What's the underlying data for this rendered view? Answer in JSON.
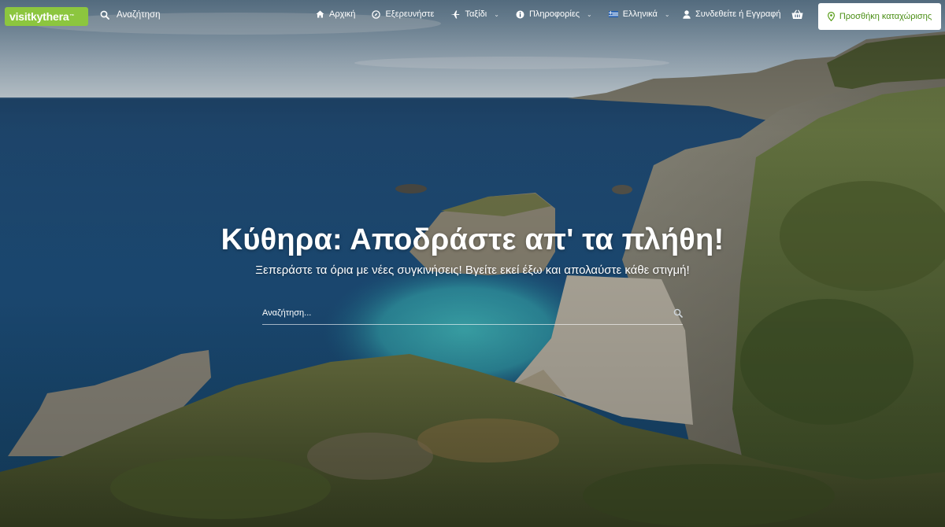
{
  "brand": {
    "logo_text": "visitkythera",
    "trademark": "™",
    "accent_color": "#8cc63f"
  },
  "header": {
    "search_label": "Αναζήτηση",
    "nav": [
      {
        "label": "Αρχική",
        "icon": "home-icon"
      },
      {
        "label": "Εξερευνήστε",
        "icon": "compass-icon"
      },
      {
        "label": "Ταξίδι",
        "icon": "plane-icon",
        "has_dropdown": true
      },
      {
        "label": "Πληροφορίες",
        "icon": "info-icon",
        "has_dropdown": true
      },
      {
        "label": "Ελληνικά",
        "icon": "greek-flag-icon",
        "has_dropdown": true
      }
    ],
    "login_label": "Συνδεθείτε ή Εγγραφή",
    "cart_icon": "basket-icon",
    "add_listing_label": "Προσθήκη καταχώρισης"
  },
  "hero": {
    "title": "Κύθηρα: Αποδράστε απ' τα πλήθη!",
    "subtitle": "Ξεπεράστε τα όρια με νέες συγκινήσεις! Βγείτε εκεί έξω και απολαύστε κάθε στιγμή!",
    "search_placeholder": "Αναζήτηση..."
  }
}
